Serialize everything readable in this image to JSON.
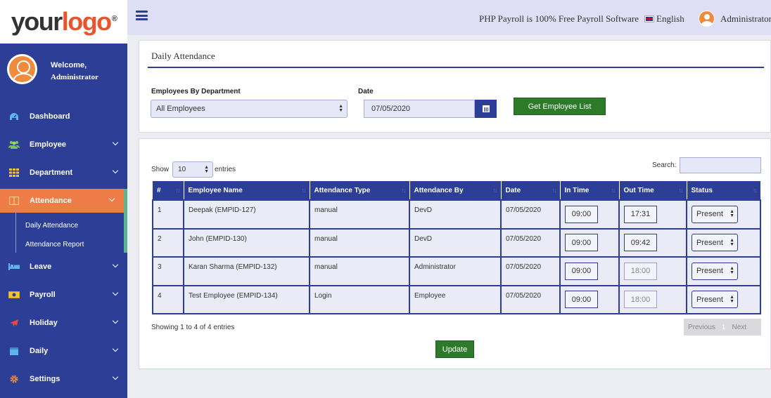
{
  "logo": {
    "part1": "your",
    "part2": "logo",
    "mark": "®"
  },
  "topbar": {
    "tagline": "PHP Payroll is 100% Free Payroll Software",
    "language": "English",
    "user": "Administrator"
  },
  "sidebar": {
    "welcome": "Welcome,",
    "username": "Administrator",
    "items": [
      {
        "label": "Dashboard"
      },
      {
        "label": "Employee"
      },
      {
        "label": "Department"
      },
      {
        "label": "Attendance"
      },
      {
        "label": "Leave"
      },
      {
        "label": "Payroll"
      },
      {
        "label": "Holiday"
      },
      {
        "label": "Daily"
      },
      {
        "label": "Settings"
      }
    ],
    "sub_items": [
      {
        "label": "Daily Attendance"
      },
      {
        "label": "Attendance Report"
      }
    ]
  },
  "filter": {
    "title": "Daily Attendance",
    "dept_label": "Employees By Department",
    "dept_value": "All Employees",
    "date_label": "Date",
    "date_value": "07/05/2020",
    "get_button": "Get Employee List"
  },
  "table_ctrl": {
    "show": "Show",
    "entries_value": "10",
    "entries": "entries",
    "search": "Search:",
    "showing": "Showing 1 to 4 of 4 entries",
    "prev": "Previous",
    "page": "1",
    "next": "Next",
    "update": "Update"
  },
  "table": {
    "headers": [
      "#",
      "Employee Name",
      "Attendance Type",
      "Attendance By",
      "Date",
      "In Time",
      "Out Time",
      "Status"
    ],
    "rows": [
      {
        "num": "1",
        "name": "Deepak (EMPID-127)",
        "type": "manual",
        "by": "DevD",
        "date": "07/05/2020",
        "in": "09:00",
        "out": "17:31",
        "status": "Present"
      },
      {
        "num": "2",
        "name": "John (EMPID-130)",
        "type": "manual",
        "by": "DevD",
        "date": "07/05/2020",
        "in": "09:00",
        "out": "09:42",
        "status": "Present"
      },
      {
        "num": "3",
        "name": "Karan Sharma (EMPID-132)",
        "type": "manual",
        "by": "Administrator",
        "date": "07/05/2020",
        "in": "09:00",
        "out": "18:00",
        "status": "Present"
      },
      {
        "num": "4",
        "name": "Test Employee (EMPID-134)",
        "type": "Login",
        "by": "Employee",
        "date": "07/05/2020",
        "in": "09:00",
        "out": "18:00",
        "status": "Present"
      }
    ]
  },
  "colors": {
    "primary": "#2c3e96",
    "accent": "#ee7c47",
    "green": "#2d7a2a"
  }
}
